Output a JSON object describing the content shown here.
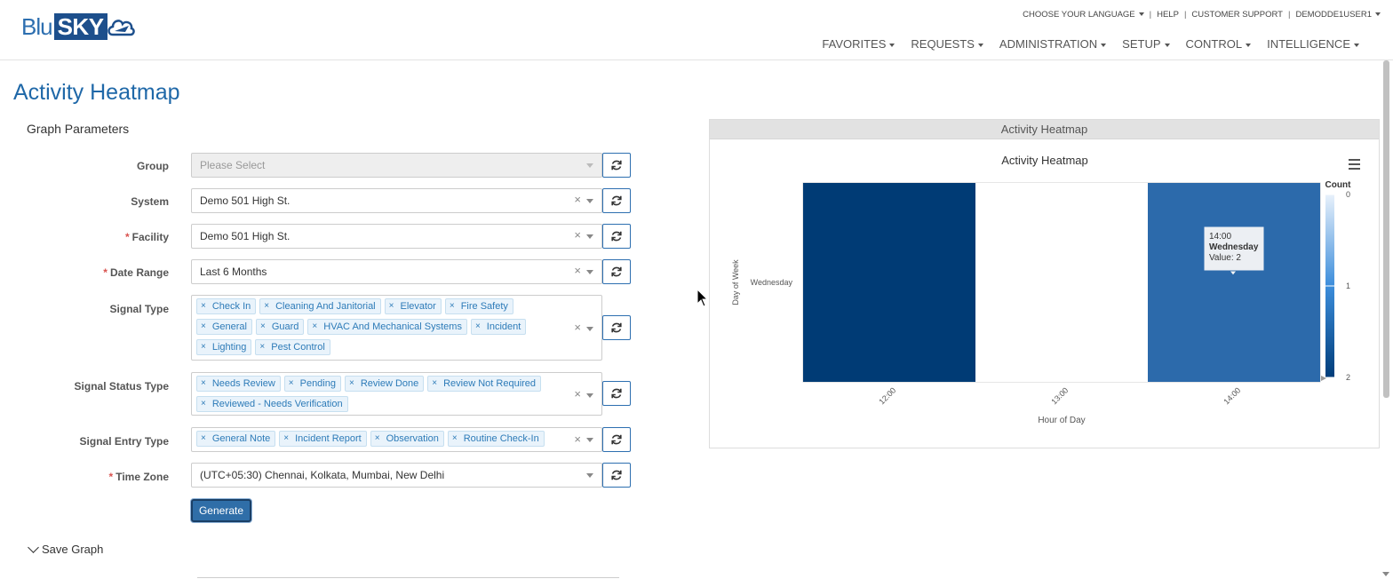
{
  "app": {
    "logo_blu": "Blu",
    "logo_sky": "SKY"
  },
  "utility_nav": {
    "language": "CHOOSE YOUR LANGUAGE",
    "help": "HELP",
    "support": "CUSTOMER SUPPORT",
    "user": "DEMODDE1USER1",
    "separator": "|"
  },
  "main_nav": [
    {
      "label": "FAVORITES"
    },
    {
      "label": "REQUESTS"
    },
    {
      "label": "ADMINISTRATION"
    },
    {
      "label": "SETUP"
    },
    {
      "label": "CONTROL"
    },
    {
      "label": "INTELLIGENCE"
    }
  ],
  "page": {
    "title": "Activity Heatmap",
    "params_title": "Graph Parameters",
    "generate_label": "Generate",
    "save_graph_label": "Save Graph"
  },
  "form": {
    "group": {
      "label": "Group",
      "placeholder": "Please Select"
    },
    "system": {
      "label": "System",
      "value": "Demo 501 High St."
    },
    "facility": {
      "label": "Facility",
      "value": "Demo 501 High St.",
      "required": "*"
    },
    "date_range": {
      "label": "Date Range",
      "value": "Last 6 Months",
      "required": "*"
    },
    "signal_type": {
      "label": "Signal Type",
      "tags": [
        "Check In",
        "Cleaning And Janitorial",
        "Elevator",
        "Fire Safety",
        "General",
        "Guard",
        "HVAC And Mechanical Systems",
        "Incident",
        "Lighting",
        "Pest Control"
      ]
    },
    "signal_status_type": {
      "label": "Signal Status Type",
      "tags": [
        "Needs Review",
        "Pending",
        "Review Done",
        "Review Not Required",
        "Reviewed - Needs Verification"
      ]
    },
    "signal_entry_type": {
      "label": "Signal Entry Type",
      "tags": [
        "General Note",
        "Incident Report",
        "Observation",
        "Routine Check-In"
      ]
    },
    "time_zone": {
      "label": "Time Zone",
      "value": "(UTC+05:30) Chennai, Kolkata, Mumbai, New Delhi",
      "required": "*"
    }
  },
  "icons": {
    "clear": "×",
    "tag_remove": "×"
  },
  "chart_panel": {
    "header": "Activity Heatmap"
  },
  "chart_data": {
    "type": "heatmap",
    "title": "Activity Heatmap",
    "xlabel": "Hour of Day",
    "ylabel": "Day of Week",
    "x_categories": [
      "12:00",
      "13:00",
      "14:00"
    ],
    "y_categories": [
      "Wednesday"
    ],
    "cells": [
      {
        "x": "12:00",
        "y": "Wednesday",
        "value": 2
      },
      {
        "x": "13:00",
        "y": "Wednesday",
        "value": 0
      },
      {
        "x": "14:00",
        "y": "Wednesday",
        "value": 2
      }
    ],
    "colorbar": {
      "title": "Count",
      "min": 0,
      "max": 2,
      "ticks": [
        "0",
        "1",
        "2"
      ],
      "colors": [
        "#e8f1fb",
        "#3c8ddb",
        "#003d7a"
      ]
    },
    "tooltip": {
      "time": "14:00",
      "day": "Wednesday",
      "value_text": "Value: 2"
    },
    "colors": {
      "high": "#003b75",
      "selected": "#2c6aab",
      "empty": "#ffffff"
    }
  }
}
